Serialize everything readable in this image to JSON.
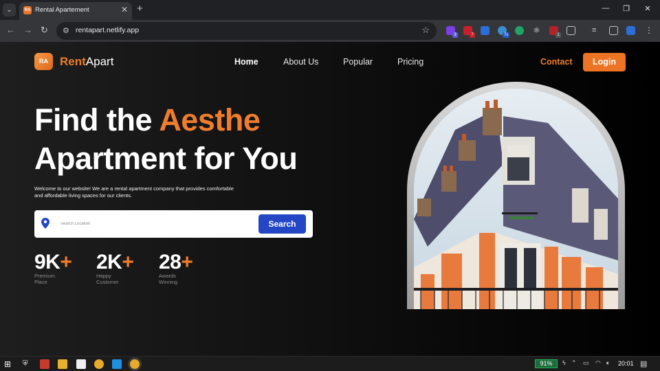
{
  "browser": {
    "tab_title": "Rental Apartement",
    "tab_favicon_text": "RA",
    "url": "rentapart.netlify.app",
    "extension_badges": [
      "3",
      "7",
      "7s",
      "1"
    ]
  },
  "site": {
    "logo_text": "RA",
    "brand_first": "Rent",
    "brand_second": "Apart",
    "nav": [
      "Home",
      "About Us",
      "Popular",
      "Pricing"
    ],
    "contact_label": "Contact",
    "login_label": "Login"
  },
  "hero": {
    "line1_plain": "Find the ",
    "line1_accent": "Aesthe",
    "line2": "Apartment for You",
    "description": "Welcome to our website! We are a rental apartment company that provides comfortable and affordable living spaces for our clients.",
    "search_placeholder": "Search Location",
    "search_button": "Search"
  },
  "stats": [
    {
      "number": "9K",
      "plus": "+",
      "label": "Premium Place"
    },
    {
      "number": "2K",
      "plus": "+",
      "label": "Happy Customer"
    },
    {
      "number": "28",
      "plus": "+",
      "label": "Awards Winning"
    }
  ],
  "taskbar": {
    "battery": "91%",
    "clock": "20:01"
  },
  "colors": {
    "accent": "#ef7d2d",
    "button_blue": "#2346c4",
    "background": "#000000"
  }
}
